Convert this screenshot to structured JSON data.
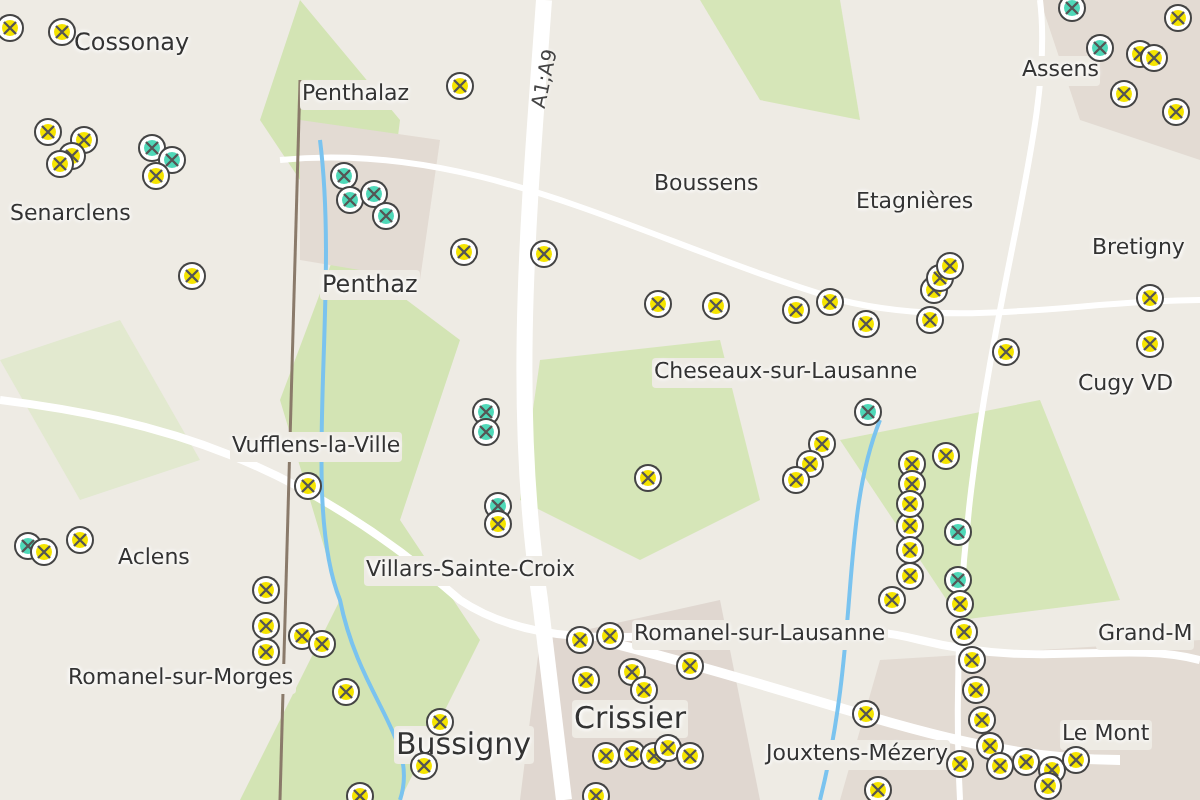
{
  "map": {
    "road_label": "A1;A9",
    "place_labels": [
      {
        "text": "Cossonay",
        "kind": "town"
      },
      {
        "text": "Penthalaz",
        "kind": "village"
      },
      {
        "text": "Senarclens",
        "kind": "village"
      },
      {
        "text": "Penthaz",
        "kind": "town"
      },
      {
        "text": "Boussens",
        "kind": "village"
      },
      {
        "text": "Assens",
        "kind": "village"
      },
      {
        "text": "Etagnières",
        "kind": "village"
      },
      {
        "text": "Bretigny",
        "kind": "village"
      },
      {
        "text": "Cheseaux-sur-Lausanne",
        "kind": "village"
      },
      {
        "text": "Cugy VD",
        "kind": "village"
      },
      {
        "text": "Vufflens-la-Ville",
        "kind": "village"
      },
      {
        "text": "Aclens",
        "kind": "village"
      },
      {
        "text": "Villars-Sainte-Croix",
        "kind": "village"
      },
      {
        "text": "Romanel-sur-Morges",
        "kind": "village"
      },
      {
        "text": "Romanel-sur-Lausanne",
        "kind": "village"
      },
      {
        "text": "Grand-M",
        "kind": "village"
      },
      {
        "text": "Crissier",
        "kind": "city"
      },
      {
        "text": "Bussigny",
        "kind": "city"
      },
      {
        "text": "Jouxtens-Mézery",
        "kind": "village"
      },
      {
        "text": "Le Mont",
        "kind": "village"
      }
    ],
    "markers": [
      {
        "color": "#f5e400"
      },
      {
        "color": "#f5e400"
      },
      {
        "color": "#f5e400"
      },
      {
        "color": "#f5e400"
      },
      {
        "color": "#4fd8b8"
      },
      {
        "color": "#4fd8b8"
      },
      {
        "color": "#f5e400"
      },
      {
        "color": "#f5e400"
      },
      {
        "color": "#4fd8b8"
      },
      {
        "color": "#f5e400"
      },
      {
        "color": "#f5e400"
      },
      {
        "color": "#f5e400"
      },
      {
        "color": "#f5e400"
      },
      {
        "color": "#f5e400"
      },
      {
        "color": "#f5e400"
      },
      {
        "color": "#f5e400"
      },
      {
        "color": "#f5e400"
      },
      {
        "color": "#f5e400"
      },
      {
        "color": "#4fd8b8"
      },
      {
        "color": "#4fd8b8"
      },
      {
        "color": "#4fd8b8"
      },
      {
        "color": "#f5e400"
      },
      {
        "color": "#4fd8b8"
      },
      {
        "color": "#4fd8b8"
      },
      {
        "color": "#4fd8b8"
      },
      {
        "color": "#4fd8b8"
      },
      {
        "color": "#f5e400"
      },
      {
        "color": "#f5e400"
      },
      {
        "color": "#f5e400"
      },
      {
        "color": "#f5e400"
      },
      {
        "color": "#f5e400"
      },
      {
        "color": "#f5e400"
      },
      {
        "color": "#f5e400"
      },
      {
        "color": "#f5e400"
      },
      {
        "color": "#f5e400"
      },
      {
        "color": "#f5e400"
      },
      {
        "color": "#f5e400"
      },
      {
        "color": "#f5e400"
      },
      {
        "color": "#f5e400"
      },
      {
        "color": "#f5e400"
      },
      {
        "color": "#4fd8b8"
      },
      {
        "color": "#f5e400"
      },
      {
        "color": "#f5e400"
      },
      {
        "color": "#f5e400"
      },
      {
        "color": "#f5e400"
      },
      {
        "color": "#f5e400"
      },
      {
        "color": "#f5e400"
      },
      {
        "color": "#f5e400"
      },
      {
        "color": "#f5e400"
      },
      {
        "color": "#f5e400"
      },
      {
        "color": "#4fd8b8"
      },
      {
        "color": "#4fd8b8"
      },
      {
        "color": "#f5e400"
      },
      {
        "color": "#f5e400"
      },
      {
        "color": "#f5e400"
      },
      {
        "color": "#f5e400"
      },
      {
        "color": "#f5e400"
      },
      {
        "color": "#f5e400"
      },
      {
        "color": "#f5e400"
      },
      {
        "color": "#f5e400"
      },
      {
        "color": "#f5e400"
      },
      {
        "color": "#f5e400"
      },
      {
        "color": "#f5e400"
      },
      {
        "color": "#f5e400"
      },
      {
        "color": "#4fd8b8"
      },
      {
        "color": "#f5e400"
      },
      {
        "color": "#4fd8b8"
      },
      {
        "color": "#f5e400"
      },
      {
        "color": "#f5e400"
      },
      {
        "color": "#f5e400"
      },
      {
        "color": "#f5e400"
      },
      {
        "color": "#f5e400"
      },
      {
        "color": "#f5e400"
      },
      {
        "color": "#f5e400"
      },
      {
        "color": "#f5e400"
      },
      {
        "color": "#f5e400"
      },
      {
        "color": "#f5e400"
      },
      {
        "color": "#f5e400"
      },
      {
        "color": "#f5e400"
      },
      {
        "color": "#f5e400"
      },
      {
        "color": "#f5e400"
      },
      {
        "color": "#f5e400"
      },
      {
        "color": "#f5e400"
      },
      {
        "color": "#f5e400"
      },
      {
        "color": "#f5e400"
      },
      {
        "color": "#f5e400"
      },
      {
        "color": "#f5e400"
      },
      {
        "color": "#f5e400"
      },
      {
        "color": "#f5e400"
      },
      {
        "color": "#f5e400"
      },
      {
        "color": "#f5e400"
      },
      {
        "color": "#f5e400"
      },
      {
        "color": "#f5e400"
      },
      {
        "color": "#f5e400"
      }
    ]
  }
}
